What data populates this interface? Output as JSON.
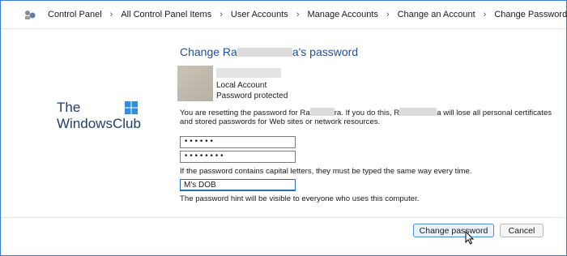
{
  "breadcrumb": {
    "items": [
      "Control Panel",
      "All Control Panel Items",
      "User Accounts",
      "Manage Accounts",
      "Change an Account",
      "Change Password"
    ]
  },
  "watermark": {
    "line1": "The",
    "line2": "WindowsClub"
  },
  "page": {
    "title_prefix": "Change Ra",
    "title_suffix": "a's password",
    "account_type": "Local Account",
    "account_status": "Password protected",
    "warning_a": "You are resetting the password for Ra",
    "warning_b": "ra.  If you do this, R",
    "warning_c": "a will lose all personal certificates",
    "warning_line2": "and stored passwords for Web sites or network resources.",
    "new_password_value": "••••••",
    "confirm_password_value": "••••••••",
    "caps_note": "If the password contains capital letters, they must be typed the same way every time.",
    "hint_value": "M's DOB",
    "hint_note": "The password hint will be visible to everyone who uses this computer."
  },
  "buttons": {
    "change_password": "Change password",
    "cancel": "Cancel"
  },
  "colors": {
    "accent": "#3a7bd5",
    "title": "#1e4f9c"
  }
}
